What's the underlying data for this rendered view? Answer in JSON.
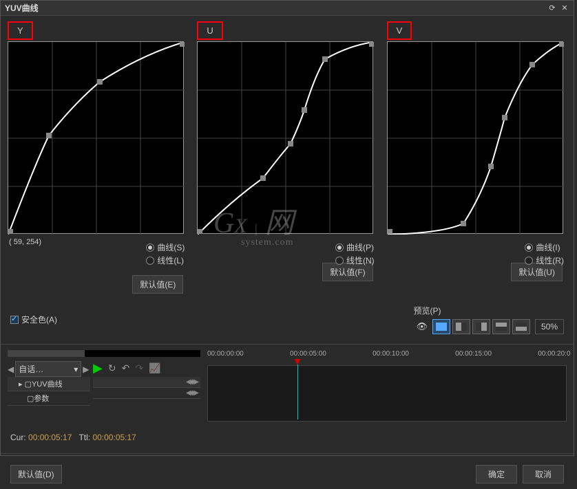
{
  "title": "YUV曲线",
  "curves": {
    "y": {
      "label": "Y",
      "radio_curve": "曲线(S)",
      "radio_linear": "线性(L)",
      "default_btn": "默认值(E)"
    },
    "u": {
      "label": "U",
      "radio_curve": "曲线(P)",
      "radio_linear": "线性(N)",
      "default_btn": "默认值(F)"
    },
    "v": {
      "label": "V",
      "radio_curve": "曲线(I)",
      "radio_linear": "线性(R)",
      "default_btn": "默认值(U)"
    }
  },
  "coord": "( 59, 254)",
  "safe_color": "安全色(A)",
  "preview": {
    "label": "预览(P)",
    "zoom": "50%"
  },
  "timeline": {
    "dropdown": "自话…",
    "row1": "YUV曲线",
    "row2": "参数",
    "ticks": [
      "00:00:00:00",
      "00:00:05:00",
      "00:00:10:00",
      "00:00:15:00",
      "00:00:20:0"
    ]
  },
  "times": {
    "cur_label": "Cur:",
    "cur_val": "00:00:05:17",
    "ttl_label": "Ttl:",
    "ttl_val": "00:00:05:17"
  },
  "footer": {
    "default": "默认值(D)",
    "ok": "确定",
    "cancel": "取消"
  },
  "chart_data": [
    {
      "type": "line",
      "title": "Y",
      "xlim": [
        0,
        255
      ],
      "ylim": [
        0,
        255
      ],
      "series": [
        {
          "name": "Y",
          "values": [
            [
              0,
              0
            ],
            [
              59,
              131
            ],
            [
              133,
              201
            ],
            [
              255,
              255
            ]
          ]
        }
      ]
    },
    {
      "type": "line",
      "title": "U",
      "xlim": [
        0,
        255
      ],
      "ylim": [
        0,
        255
      ],
      "series": [
        {
          "name": "U",
          "values": [
            [
              0,
              0
            ],
            [
              95,
              75
            ],
            [
              135,
              120
            ],
            [
              155,
              165
            ],
            [
              185,
              232
            ],
            [
              255,
              255
            ]
          ]
        }
      ]
    },
    {
      "type": "line",
      "title": "V",
      "xlim": [
        0,
        255
      ],
      "ylim": [
        0,
        255
      ],
      "series": [
        {
          "name": "V",
          "values": [
            [
              0,
              0
            ],
            [
              110,
              15
            ],
            [
              150,
              90
            ],
            [
              170,
              155
            ],
            [
              210,
              225
            ],
            [
              255,
              255
            ]
          ]
        }
      ]
    }
  ]
}
